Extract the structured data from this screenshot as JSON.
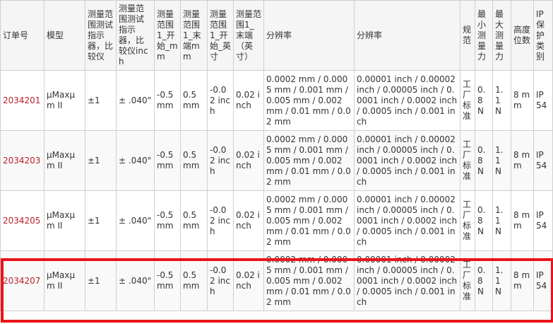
{
  "headers": [
    "订单号",
    "模型",
    "测量范围测试指示器，比较仪",
    "测量范围测试指示器，比较仪inch",
    "测量范围1_开始_mm",
    "测量范围1_末端mm",
    "测量范围1_开始_英寸",
    "测量范围1_末端（英寸）",
    "分辨率",
    "分辨率",
    "规范",
    "最小测量力",
    "最大测量力",
    "高度位数",
    "IP保护类别"
  ],
  "rows": [
    {
      "order": "2034201",
      "model": "µMaxµm II",
      "range_mm": "±1",
      "range_inch": "± .040\"",
      "start_mm": "-0.5 mm",
      "end_mm": "0.5 mm",
      "start_inch": "-0.02 inch",
      "end_inch": "0.02 inch",
      "res_mm": "0.0002 mm / 0.0005 mm / 0.001 mm / 0.005 mm / 0.002 mm / 0.01 mm / 0.02 mm",
      "res_inch": "0.00001 inch / 0.00002 inch / 0.00005 inch / 0.0001 inch / 0.0002 inch / 0.0005 inch / 0.001 inch",
      "spec": "工厂标准",
      "min_force": "0.8 N",
      "max_force": "1.1 N",
      "digits": "8 mm",
      "ip": "IP 54"
    },
    {
      "order": "2034203",
      "model": "µMaxµm II",
      "range_mm": "±1",
      "range_inch": "± .040\"",
      "start_mm": "-0.5 mm",
      "end_mm": "0.5 mm",
      "start_inch": "-0.02 inch",
      "end_inch": "0.02 inch",
      "res_mm": "0.0002 mm / 0.0005 mm / 0.001 mm / 0.005 mm / 0.002 mm / 0.01 mm / 0.02 mm",
      "res_inch": "0.00001 inch / 0.00002 inch / 0.00005 inch / 0.0001 inch / 0.0002 inch / 0.0005 inch / 0.001 inch",
      "spec": "工厂标准",
      "min_force": "0.8 N",
      "max_force": "1.1 N",
      "digits": "8 mm",
      "ip": "IP 54"
    },
    {
      "order": "2034205",
      "model": "µMaxµm II",
      "range_mm": "±1",
      "range_inch": "± .040\"",
      "start_mm": "-0.5 mm",
      "end_mm": "0.5 mm",
      "start_inch": "-0.02 inch",
      "end_inch": "0.02 inch",
      "res_mm": "0.0002 mm / 0.0005 mm / 0.001 mm / 0.005 mm / 0.002 mm / 0.01 mm / 0.02 mm",
      "res_inch": "0.00001 inch / 0.00002 inch / 0.00005 inch / 0.0001 inch / 0.0002 inch / 0.0005 inch / 0.001 inch",
      "spec": "工厂标准",
      "min_force": "0.8 N",
      "max_force": "1.1 N",
      "digits": "8 mm",
      "ip": "IP 54"
    },
    {
      "order": "2034207",
      "model": "µMaxµm II",
      "range_mm": "±1",
      "range_inch": "± .040\"",
      "start_mm": "-0.5 mm",
      "end_mm": "0.5 mm",
      "start_inch": "-0.02 inch",
      "end_inch": "0.02 inch",
      "res_mm": "0.0002 mm / 0.0005 mm / 0.001 mm / 0.005 mm / 0.002 mm / 0.01 mm / 0.02 mm",
      "res_inch": "0.00001 inch / 0.00002 inch / 0.00005 inch / 0.0001 inch / 0.0002 inch / 0.0005 inch / 0.001 inch",
      "spec": "工厂标准",
      "min_force": "0.8 N",
      "max_force": "1.1 N",
      "digits": "8 mm",
      "ip": "IP 54"
    }
  ],
  "colors": {
    "link": "#b8202a",
    "highlight": "#e8141b",
    "border": "#cfcfcf",
    "header_bg": "#f5f5f5"
  }
}
